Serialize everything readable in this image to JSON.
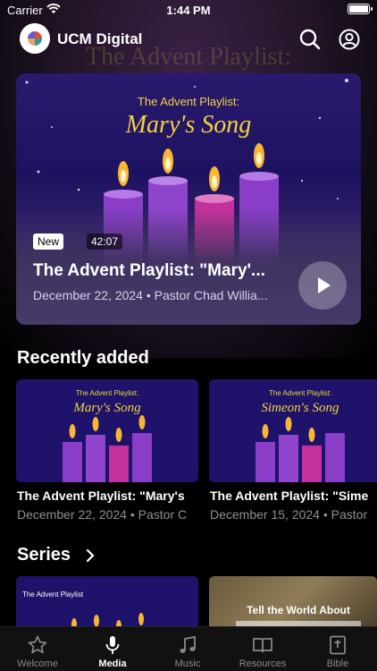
{
  "status_bar": {
    "carrier": "Carrier",
    "time": "1:44 PM"
  },
  "header": {
    "app_title": "UCM Digital"
  },
  "background": {
    "ghost_title": "The Advent Playlist:"
  },
  "featured": {
    "art_kicker": "The Advent Playlist:",
    "art_title": "Mary's Song",
    "badge": "New",
    "duration": "42:07",
    "title": "The Advent Playlist: \"Mary'...",
    "meta": "December 22, 2024 • Pastor Chad Willia..."
  },
  "recently_added": {
    "heading": "Recently added",
    "items": [
      {
        "art_kicker": "The Advent Playlist:",
        "art_title": "Mary's Song",
        "title": "The Advent Playlist: \"Mary's",
        "meta": "December 22, 2024 • Pastor C"
      },
      {
        "art_kicker": "The Advent Playlist:",
        "art_title": "Simeon's Song",
        "title": "The Advent Playlist: \"Sime",
        "meta": "December 15, 2024 • Pastor"
      }
    ]
  },
  "series": {
    "heading": "Series",
    "items": [
      {
        "art_text": "The Advent Playlist"
      },
      {
        "art_text": "Tell the World About"
      }
    ]
  },
  "tab_bar": {
    "items": [
      {
        "label": "Welcome",
        "icon": "star-icon",
        "active": false
      },
      {
        "label": "Media",
        "icon": "microphone-icon",
        "active": true
      },
      {
        "label": "Music",
        "icon": "music-note-icon",
        "active": false
      },
      {
        "label": "Resources",
        "icon": "book-open-icon",
        "active": false
      },
      {
        "label": "Bible",
        "icon": "bible-icon",
        "active": false
      }
    ]
  },
  "colors": {
    "accent_candle": "#9b4fd6",
    "flame": "#f7b733",
    "art_title": "#f2d33c"
  }
}
